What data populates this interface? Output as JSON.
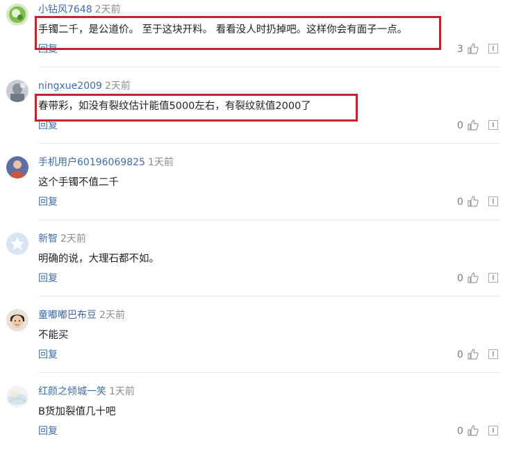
{
  "comments": [
    {
      "username": "小钻风7648",
      "time": "2天前",
      "text": "手镯二千，是公道价。 至于这块开料。 看看没人时扔掉吧。这样你会有面子一点。",
      "reply_label": "回复",
      "likes": "3",
      "avatar": "green-abstract-avatar"
    },
    {
      "username": "ningxue2009",
      "time": "2天前",
      "text": "春带彩，如没有裂纹估计能值5000左右，有裂纹就值2000了",
      "reply_label": "回复",
      "likes": "0",
      "avatar": "blurred-photo-avatar"
    },
    {
      "username": "手机用户60196069825",
      "time": "1天前",
      "text": "这个手镯不值二千",
      "reply_label": "回复",
      "likes": "0",
      "avatar": "default-user-avatar"
    },
    {
      "username": "新智",
      "time": "2天前",
      "text": "明确的说，大理石都不如。",
      "reply_label": "回复",
      "likes": "0",
      "avatar": "default-star-avatar"
    },
    {
      "username": "童嘟嘟巴布豆",
      "time": "2天前",
      "text": "不能买",
      "reply_label": "回复",
      "likes": "0",
      "avatar": "child-photo-avatar"
    },
    {
      "username": "红颜之倾城一笑",
      "time": "1天前",
      "text": "B货加裂值几十吧",
      "reply_label": "回复",
      "likes": "0",
      "avatar": "pale-photo-avatar"
    }
  ],
  "colors": {
    "username": "#3e6ba8",
    "time": "#8c8c8c",
    "text": "#222222",
    "highlight_border": "#c0252d"
  }
}
